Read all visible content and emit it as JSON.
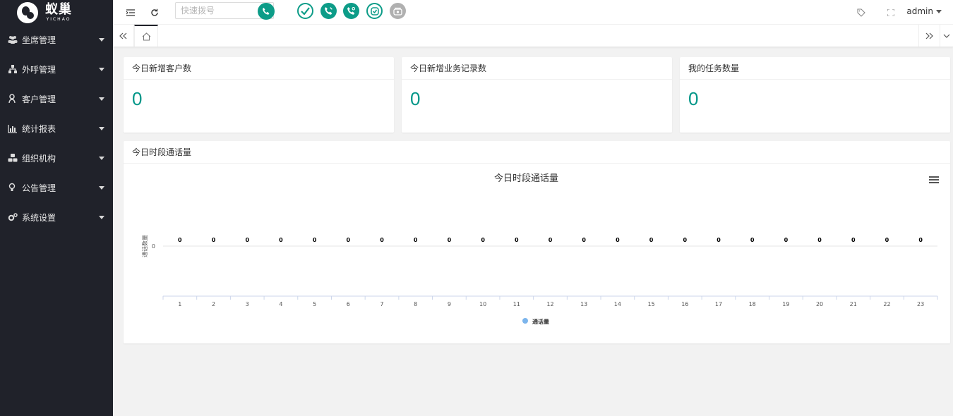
{
  "brand": {
    "name": "蚁巢",
    "sub": "YICHAO"
  },
  "sidebar": {
    "items": [
      {
        "label": "坐席管理",
        "icon": "users-icon"
      },
      {
        "label": "外呼管理",
        "icon": "sitemap-icon"
      },
      {
        "label": "客户管理",
        "icon": "user-icon"
      },
      {
        "label": "统计报表",
        "icon": "bar-chart-icon"
      },
      {
        "label": "组织机构",
        "icon": "cubes-icon"
      },
      {
        "label": "公告管理",
        "icon": "lightbulb-icon"
      },
      {
        "label": "系统设置",
        "icon": "cogs-icon"
      }
    ]
  },
  "header": {
    "dial_placeholder": "快速拨号",
    "user": "admin"
  },
  "colors": {
    "sidebar": "#20222a",
    "accent": "#009688",
    "status_green": "#0d9c88",
    "status_gray": "#b0b0b0"
  },
  "stats": [
    {
      "title": "今日新增客户数",
      "value": "0"
    },
    {
      "title": "今日新增业务记录数",
      "value": "0"
    },
    {
      "title": "我的任务数量",
      "value": "0"
    }
  ],
  "chart_panel": {
    "title": "今日时段通话量"
  },
  "chart_data": {
    "type": "bar",
    "title": "今日时段通话量",
    "ylabel": "通话数量",
    "xlabel": "",
    "categories": [
      "1",
      "2",
      "3",
      "4",
      "5",
      "6",
      "7",
      "8",
      "9",
      "10",
      "11",
      "12",
      "13",
      "14",
      "15",
      "16",
      "17",
      "18",
      "19",
      "20",
      "21",
      "22",
      "23"
    ],
    "series": [
      {
        "name": "通话量",
        "values": [
          0,
          0,
          0,
          0,
          0,
          0,
          0,
          0,
          0,
          0,
          0,
          0,
          0,
          0,
          0,
          0,
          0,
          0,
          0,
          0,
          0,
          0,
          0
        ]
      }
    ],
    "y_ticks": [
      "0"
    ],
    "legend": "bottom-center"
  }
}
